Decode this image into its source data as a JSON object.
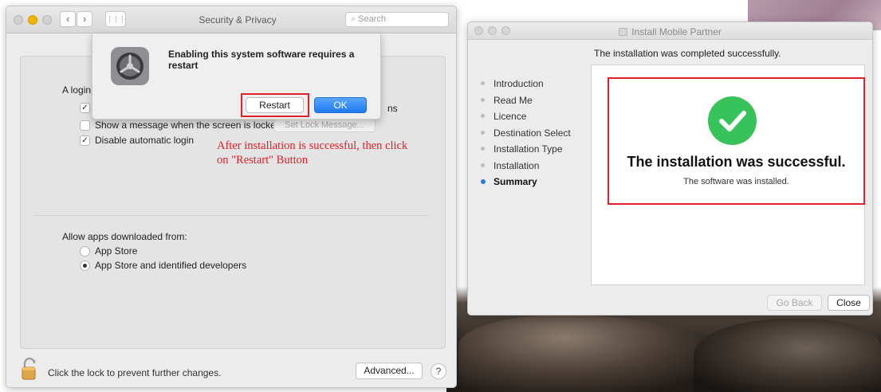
{
  "security_window": {
    "title": "Security & Privacy",
    "search_placeholder": "Search",
    "nav_back": "‹",
    "nav_forward": "›",
    "grid_glyph": "⋮⋮⋮",
    "login_label": "A login",
    "login_suffix": "ns",
    "show_message_label": "Show a message when the screen is locked",
    "set_lock_message_button": "Set Lock Message...",
    "disable_auto_login_label": "Disable automatic login",
    "allow_apps_label": "Allow apps downloaded from:",
    "option_app_store": "App Store",
    "option_identified": "App Store and identified developers",
    "lock_text": "Click the lock to prevent further changes.",
    "advanced_button": "Advanced...",
    "help_button": "?",
    "checkbox_states": {
      "login_option": true,
      "show_message": false,
      "disable_auto_login": true
    },
    "selected_source": "App Store and identified developers"
  },
  "alert": {
    "message": "Enabling this system software requires a restart",
    "restart_button": "Restart",
    "ok_button": "OK",
    "icon": "gear-icon"
  },
  "annotation": {
    "line1": "After installation is successful, then click",
    "line2": "on \"Restart\" Button",
    "color": "#e0202a"
  },
  "installer": {
    "title": "Install Mobile Partner",
    "header": "The installation was completed successfully.",
    "steps": [
      {
        "label": "Introduction",
        "active": false
      },
      {
        "label": "Read Me",
        "active": false
      },
      {
        "label": "Licence",
        "active": false
      },
      {
        "label": "Destination Select",
        "active": false
      },
      {
        "label": "Installation Type",
        "active": false
      },
      {
        "label": "Installation",
        "active": false
      },
      {
        "label": "Summary",
        "active": true
      }
    ],
    "result_title": "The installation was successful.",
    "result_subtitle": "The software was installed.",
    "go_back_button": "Go Back",
    "close_button": "Close",
    "success_color": "#37c25a"
  },
  "colors": {
    "accent_blue": "#1d78f2",
    "highlight_red": "#e0202a",
    "traffic_yellow": "#f5b400"
  }
}
